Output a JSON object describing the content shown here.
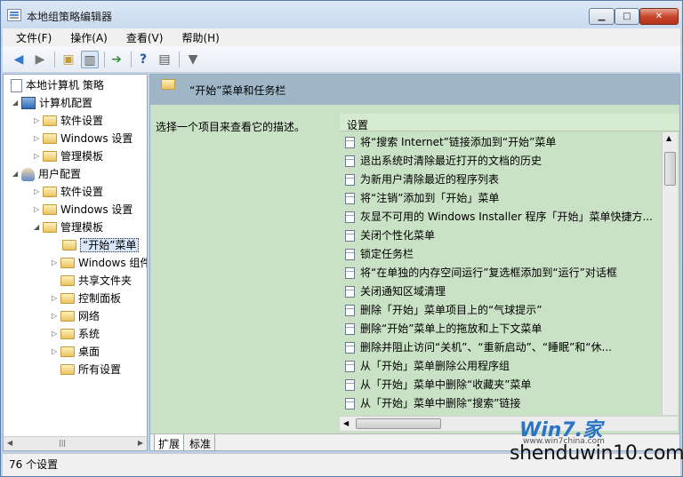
{
  "window": {
    "title": "本地组策略编辑器",
    "minimize": "▁",
    "maximize": "□",
    "close": "✕"
  },
  "menu": [
    "文件(F)",
    "操作(A)",
    "查看(V)",
    "帮助(H)"
  ],
  "toolbar": {
    "back_icon": "back-arrow-icon",
    "forward_icon": "forward-arrow-icon"
  },
  "tree": {
    "root": "本地计算机 策略",
    "computer_config": "计算机配置",
    "cc_software": "软件设置",
    "cc_windows": "Windows 设置",
    "cc_admin": "管理模板",
    "user_config": "用户配置",
    "uc_software": "软件设置",
    "uc_windows": "Windows 设置",
    "uc_admin": "管理模板",
    "start_menu": "“开始”菜单",
    "windows_comp": "Windows 组件",
    "shared_folders": "共享文件夹",
    "control_panel": "控制面板",
    "network": "网络",
    "system": "系统",
    "desktop": "桌面",
    "all_settings": "所有设置"
  },
  "panel": {
    "header": "“开始”菜单和任务栏",
    "description": "选择一个项目来查看它的描述。",
    "column_setting": "设置"
  },
  "settings": [
    "将“搜索 Internet”链接添加到“开始”菜单",
    "退出系统时清除最近打开的文档的历史",
    "为新用户清除最近的程序列表",
    "将“注销”添加到「开始」菜单",
    "灰显不可用的 Windows Installer 程序「开始」菜单快捷方...",
    "关闭个性化菜单",
    "锁定任务栏",
    "将“在单独的内存空间运行”复选框添加到“运行”对话框",
    "关闭通知区域清理",
    "删除「开始」菜单项目上的“气球提示”",
    "删除“开始”菜单上的拖放和上下文菜单",
    "删除并阻止访问“关机”、“重新启动”、“睡眠”和“休...",
    "从「开始」菜单删除公用程序组",
    "从「开始」菜单中删除“收藏夹”菜单",
    "从「开始」菜单中删除“搜索”链接"
  ],
  "tabs": [
    "扩展",
    "标准"
  ],
  "status": "76 个设置",
  "watermark": {
    "logo": "Win7.家",
    "small": "www.win7china.com",
    "site": "shenduwin10.com"
  }
}
